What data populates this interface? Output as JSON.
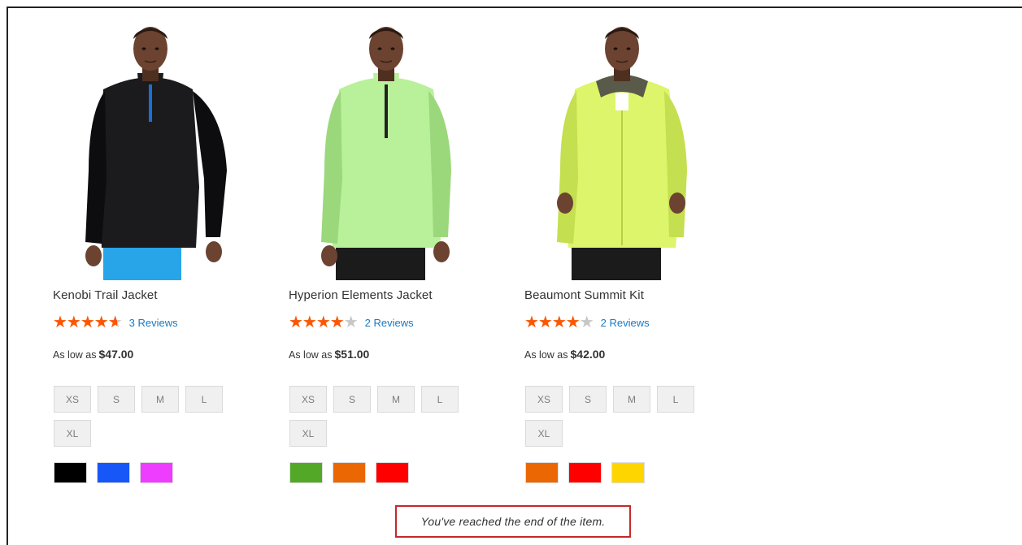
{
  "products": [
    {
      "name": "Kenobi Trail Jacket",
      "rating_fraction": 0.93,
      "reviews": "3 Reviews",
      "price_label": "As low as",
      "price": "$47.00",
      "sizes": [
        "XS",
        "S",
        "M",
        "L",
        "XL"
      ],
      "colors": [
        "#000000",
        "#1857f7",
        "#ef3dff"
      ],
      "image": {
        "jacket_color": "#1b1b1d",
        "jacket_shade": "#0d0d0f",
        "accent": "#1a6fd6",
        "pants_color": "#27a5e8"
      }
    },
    {
      "name": "Hyperion Elements Jacket",
      "rating_fraction": 0.8,
      "reviews": "2 Reviews",
      "price_label": "As low as",
      "price": "$51.00",
      "sizes": [
        "XS",
        "S",
        "M",
        "L",
        "XL"
      ],
      "colors": [
        "#53a828",
        "#eb6703",
        "#ff0000"
      ],
      "image": {
        "jacket_color": "#b9f09a",
        "jacket_shade": "#9bd87c",
        "accent": "#222222",
        "pants_color": "#1b1b1b"
      }
    },
    {
      "name": "Beaumont Summit Kit",
      "rating_fraction": 0.8,
      "reviews": "2 Reviews",
      "price_label": "As low as",
      "price": "$42.00",
      "sizes": [
        "XS",
        "S",
        "M",
        "L",
        "XL"
      ],
      "colors": [
        "#eb6703",
        "#ff0000",
        "#ffd500"
      ],
      "image": {
        "jacket_color": "#dcf56a",
        "jacket_shade": "#c4df4f",
        "accent": "#3a3a3a",
        "pants_color": "#1b1b1b"
      }
    }
  ],
  "end_message": "You've reached the end of the item."
}
